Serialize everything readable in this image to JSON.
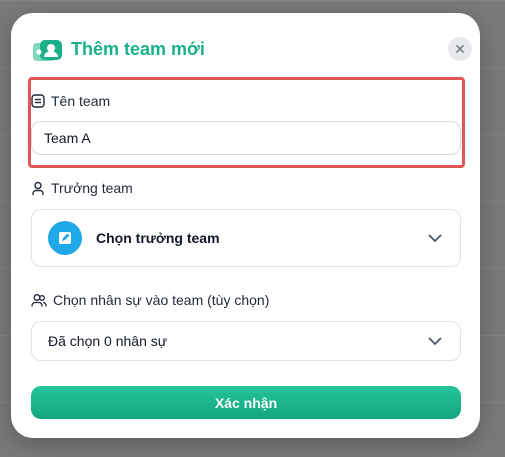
{
  "dialog": {
    "title": "Thêm team mới",
    "close_icon": "close-icon",
    "logo_icon": "team-logo-icon"
  },
  "team_name": {
    "label": "Tên team",
    "icon": "text-field-icon",
    "value": "Team A"
  },
  "team_leader": {
    "label": "Trưởng team",
    "icon": "person-icon",
    "select_text": "Chọn trưởng team",
    "select_icon": "edit-icon"
  },
  "members": {
    "label": "Chọn nhân sự vào team (tùy chọn)",
    "icon": "people-icon",
    "select_text": "Đã chọn 0 nhân sự"
  },
  "submit_label": "Xác nhận",
  "colors": {
    "accent": "#19b08a",
    "highlight": "#e05555",
    "leader_icon_bg": "#1fa9e8"
  }
}
